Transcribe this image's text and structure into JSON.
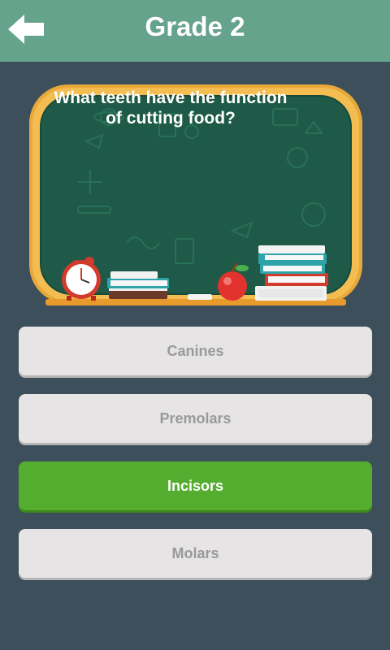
{
  "header": {
    "title": "Grade 2"
  },
  "question": {
    "text": "What teeth have the function of cutting food?"
  },
  "answers": [
    {
      "label": "Canines",
      "state": "default"
    },
    {
      "label": "Premolars",
      "state": "default"
    },
    {
      "label": "Incisors",
      "state": "correct"
    },
    {
      "label": "Molars",
      "state": "default"
    }
  ],
  "colors": {
    "topbar": "#65a38c",
    "background": "#3d4f5a",
    "correct": "#55ad2f",
    "default_answer": "#e6e4e4",
    "chalkboard": "#1e5a47",
    "frame": "#e8a93a"
  }
}
